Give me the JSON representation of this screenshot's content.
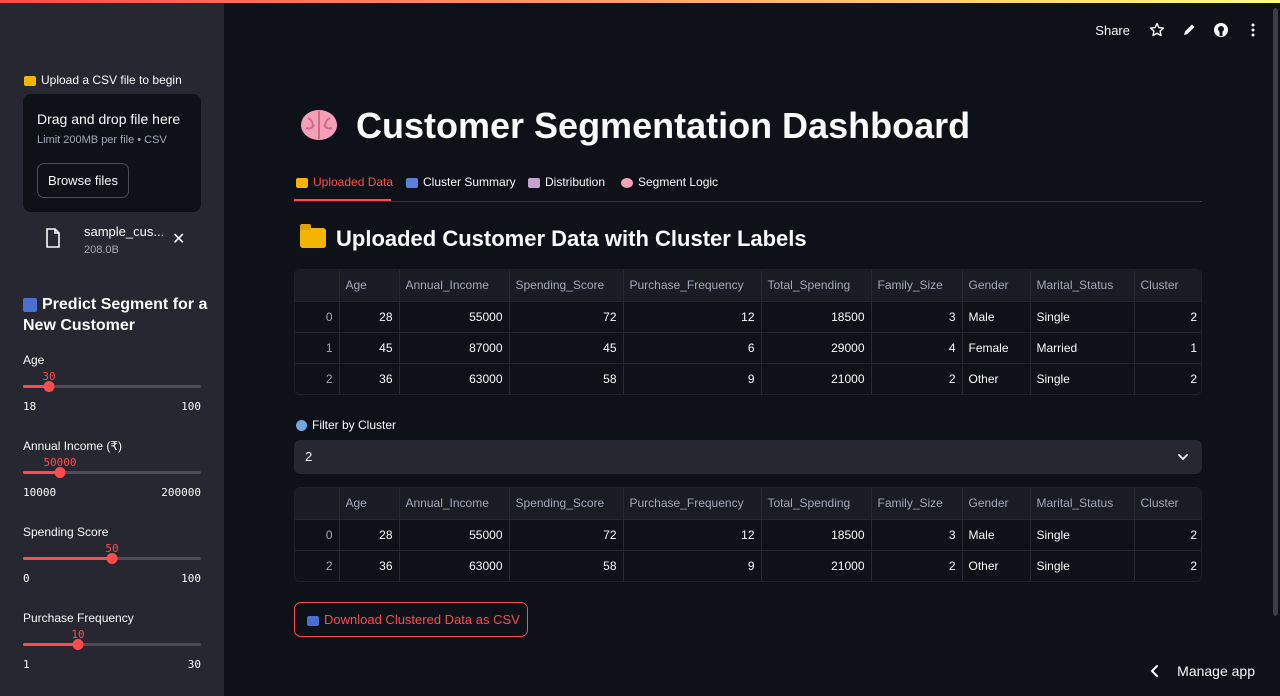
{
  "sidebar": {
    "upload_label": "Upload a CSV file to begin",
    "dropzone": {
      "title": "Drag and drop file here",
      "limit": "Limit 200MB per file • CSV",
      "browse_label": "Browse files"
    },
    "file": {
      "name": "sample_cus...",
      "size": "208.0B"
    },
    "predict_title": "Predict Segment for a New Customer",
    "sliders": [
      {
        "label": "Age",
        "value": "30",
        "min": "18",
        "max": "100",
        "fraction": 0.146
      },
      {
        "label": "Annual Income (₹)",
        "value": "50000",
        "min": "10000",
        "max": "200000",
        "fraction": 0.21
      },
      {
        "label": "Spending Score",
        "value": "50",
        "min": "0",
        "max": "100",
        "fraction": 0.5
      },
      {
        "label": "Purchase Frequency",
        "value": "10",
        "min": "1",
        "max": "30",
        "fraction": 0.31
      }
    ]
  },
  "header": {
    "share_label": "Share",
    "icons": [
      "star-icon",
      "pencil-icon",
      "github-icon",
      "more-vertical-icon"
    ]
  },
  "main": {
    "title": "Customer Segmentation Dashboard",
    "tabs": [
      {
        "label": "Uploaded Data",
        "icon": "folder-icon",
        "active": true
      },
      {
        "label": "Cluster Summary",
        "icon": "bar-chart-icon",
        "active": false
      },
      {
        "label": "Distribution",
        "icon": "chart-icon",
        "active": false
      },
      {
        "label": "Segment Logic",
        "icon": "brain-icon",
        "active": false
      }
    ],
    "section_title": "Uploaded Customer Data with Cluster Labels",
    "columns": [
      "",
      "Age",
      "Annual_Income",
      "Spending_Score",
      "Purchase_Frequency",
      "Total_Spending",
      "Family_Size",
      "Gender",
      "Marital_Status",
      "Cluster"
    ],
    "table1": [
      [
        "0",
        "28",
        "55000",
        "72",
        "12",
        "18500",
        "3",
        "Male",
        "Single",
        "2"
      ],
      [
        "1",
        "45",
        "87000",
        "45",
        "6",
        "29000",
        "4",
        "Female",
        "Married",
        "1"
      ],
      [
        "2",
        "36",
        "63000",
        "58",
        "9",
        "21000",
        "2",
        "Other",
        "Single",
        "2"
      ]
    ],
    "filter_label": "Filter by Cluster",
    "filter_value": "2",
    "table2": [
      [
        "0",
        "28",
        "55000",
        "72",
        "12",
        "18500",
        "3",
        "Male",
        "Single",
        "2"
      ],
      [
        "2",
        "36",
        "63000",
        "58",
        "9",
        "21000",
        "2",
        "Other",
        "Single",
        "2"
      ]
    ],
    "download_label": "Download Clustered Data as CSV"
  },
  "footer": {
    "manage_label": "Manage app"
  },
  "colors": {
    "accent": "#ff4b4b",
    "background": "#0e1117",
    "sidebar": "#262730"
  }
}
